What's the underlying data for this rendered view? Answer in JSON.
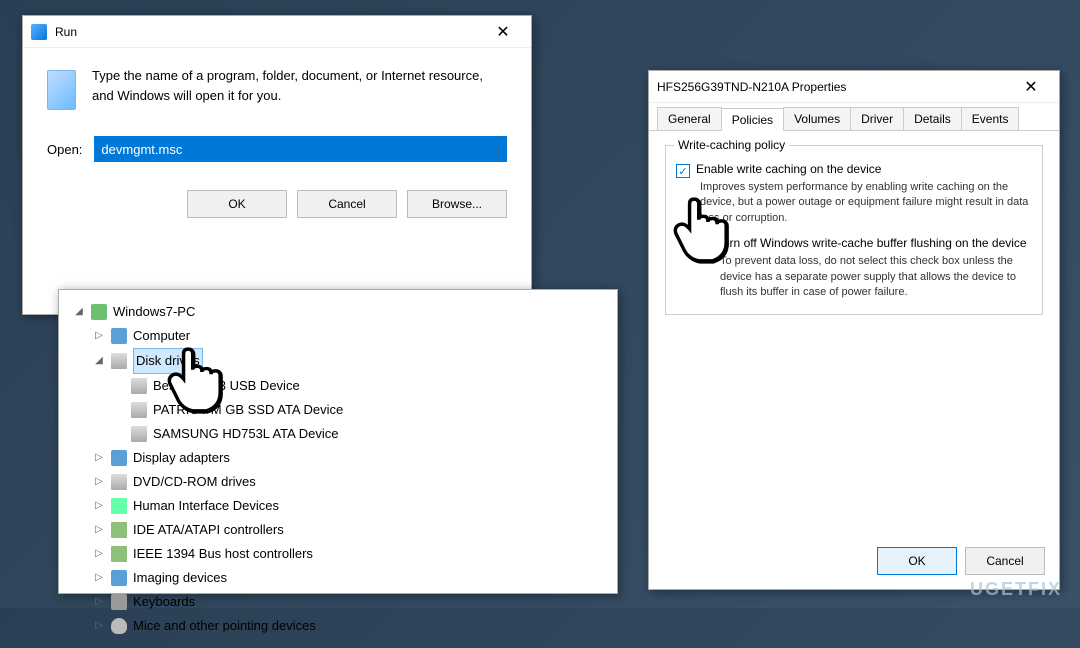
{
  "run": {
    "title": "Run",
    "description": "Type the name of a program, folder, document, or Internet resource, and Windows will open it for you.",
    "open_label": "Open:",
    "input_value": "devmgmt.msc",
    "buttons": {
      "ok": "OK",
      "cancel": "Cancel",
      "browse": "Browse..."
    }
  },
  "devmgr": {
    "root": "Windows7-PC",
    "items": [
      {
        "label": "Computer",
        "icon": "monitor"
      },
      {
        "label": "Disk drives",
        "icon": "drive",
        "expanded": true,
        "selected": true
      },
      {
        "label": "BestBuy G            3 USB Device",
        "icon": "drive",
        "child": true
      },
      {
        "label": "PATRIOT M            GB SSD ATA Device",
        "icon": "drive",
        "child": true
      },
      {
        "label": "SAMSUNG HD753L  ATA Device",
        "icon": "drive",
        "child": true
      },
      {
        "label": "Display adapters",
        "icon": "monitor"
      },
      {
        "label": "DVD/CD-ROM drives",
        "icon": "drive"
      },
      {
        "label": "Human Interface Devices",
        "icon": "usb"
      },
      {
        "label": "IDE ATA/ATAPI controllers",
        "icon": "chip"
      },
      {
        "label": "IEEE 1394 Bus host controllers",
        "icon": "chip"
      },
      {
        "label": "Imaging devices",
        "icon": "monitor"
      },
      {
        "label": "Keyboards",
        "icon": "kb"
      },
      {
        "label": "Mice and other pointing devices",
        "icon": "mouse"
      }
    ]
  },
  "props": {
    "title": "HFS256G39TND-N210A Properties",
    "tabs": [
      "General",
      "Policies",
      "Volumes",
      "Driver",
      "Details",
      "Events"
    ],
    "active_tab": "Policies",
    "group_legend": "Write-caching policy",
    "cb1_label": "Enable write caching on the device",
    "cb1_desc": "Improves system performance by enabling write caching on the device, but a power outage or equipment failure might result in data loss or corruption.",
    "cb2_label": "Turn off Windows write-cache buffer flushing on the device",
    "cb2_desc": "To prevent data loss, do not select this check box unless the device has a separate power supply that allows the device to flush its buffer in case of power failure.",
    "ok": "OK",
    "cancel": "Cancel"
  },
  "watermark": "UGETFIX"
}
